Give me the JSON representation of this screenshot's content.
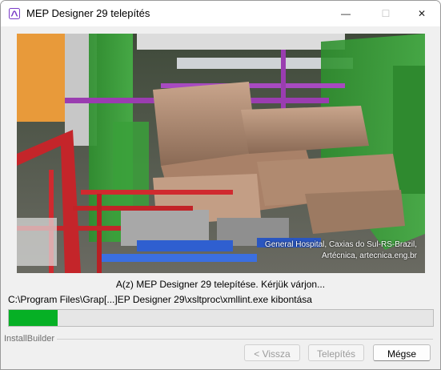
{
  "window": {
    "title": "MEP Designer 29 telepítés",
    "controls": {
      "minimize": "—",
      "maximize": "☐",
      "close": "✕"
    }
  },
  "banner": {
    "credit_line1": "General Hospital, Caxias do Sul-RS-Brazil,",
    "credit_line2": "Artécnica, artecnica.eng.br"
  },
  "status_text": "A(z) MEP Designer 29 telepítése. Kérjük várjon...",
  "file_text": "C:\\Program Files\\Grap[...]EP Designer 29\\xsltproc\\xmllint.exe kibontása",
  "progress": {
    "fraction": 0.115,
    "fill_color": "#06b025"
  },
  "group_label": "InstallBuilder",
  "buttons": {
    "back": "< Vissza",
    "install": "Telepítés",
    "cancel": "Mégse"
  }
}
